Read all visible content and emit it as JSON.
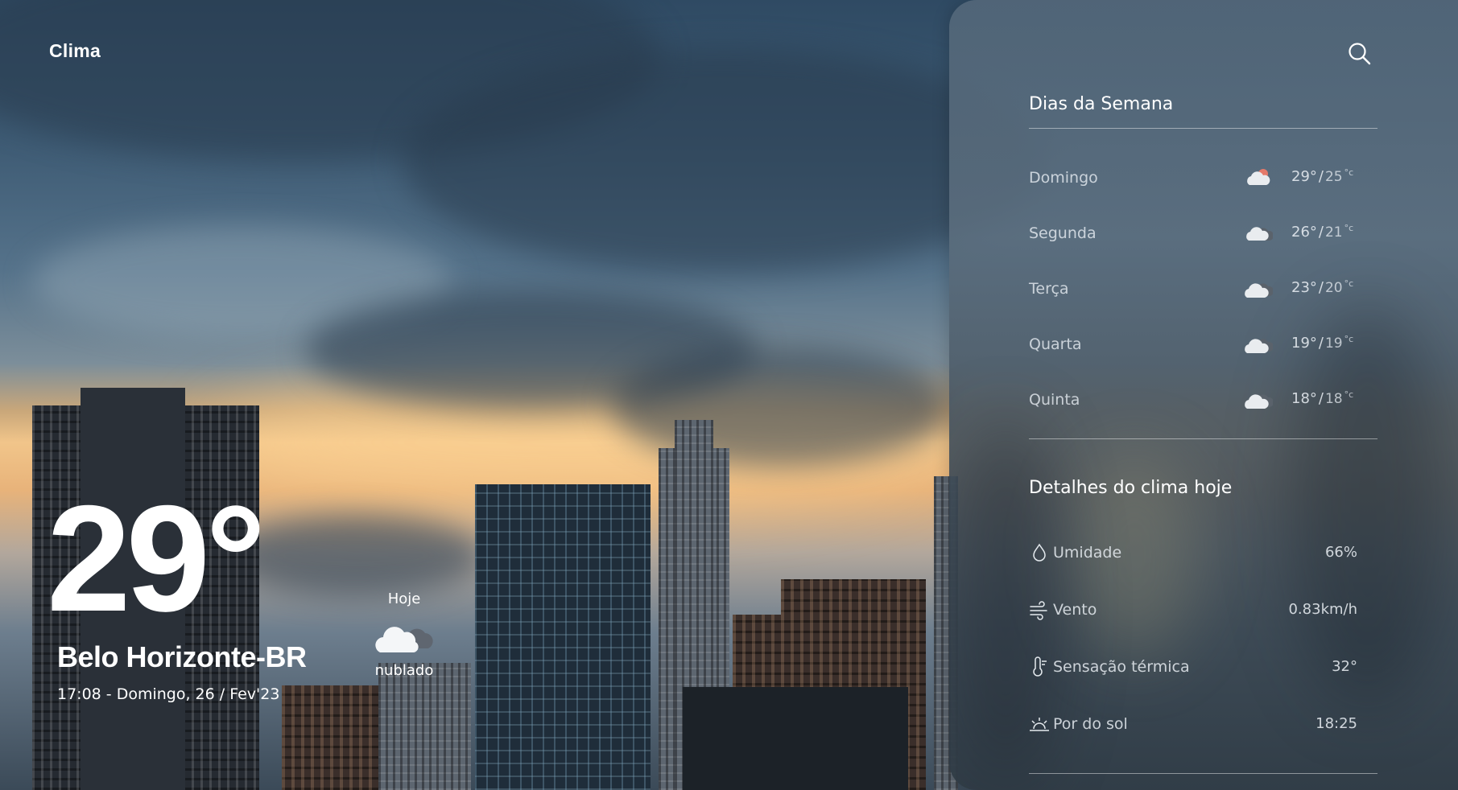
{
  "app": {
    "title": "Clima"
  },
  "current": {
    "temperature": "29°",
    "city": "Belo Horizonte-BR",
    "datetime": "17:08 - Domingo, 26 / Fev'23",
    "today_label": "Hoje",
    "condition": "nublado",
    "condition_icon": "cloud-icon"
  },
  "panel": {
    "search_icon": "search-icon",
    "week_title": "Dias da Semana",
    "days": [
      {
        "name": "Domingo",
        "max": "29°",
        "min": "25",
        "unit": "°c",
        "icon": "partly-cloudy-sun-icon"
      },
      {
        "name": "Segunda",
        "max": "26°",
        "min": "21",
        "unit": "°c",
        "icon": "cloud-icon"
      },
      {
        "name": "Terça",
        "max": "23°",
        "min": "20",
        "unit": "°c",
        "icon": "cloud-icon"
      },
      {
        "name": "Quarta",
        "max": "19°",
        "min": "19",
        "unit": "°c",
        "icon": "cloud-icon"
      },
      {
        "name": "Quinta",
        "max": "18°",
        "min": "18",
        "unit": "°c",
        "icon": "cloud-icon"
      }
    ],
    "details_title": "Detalhes do clima hoje",
    "details": [
      {
        "label": "Umidade",
        "value": "66%",
        "icon": "droplet-icon"
      },
      {
        "label": "Vento",
        "value": "0.83km/h",
        "icon": "wind-icon"
      },
      {
        "label": "Sensação térmica",
        "value": "32°",
        "icon": "thermometer-icon"
      },
      {
        "label": "Por do sol",
        "value": "18:25",
        "icon": "sunset-icon"
      }
    ]
  },
  "colors": {
    "text": "#ffffff",
    "panel": "#566a7c",
    "sky_dark": "#2f4a63",
    "sunset": "#f1c58a"
  }
}
